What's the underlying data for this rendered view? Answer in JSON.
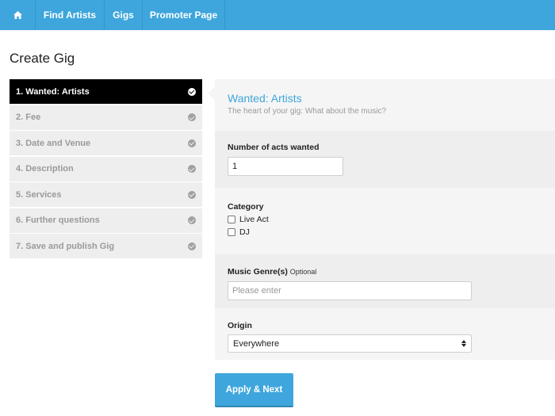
{
  "nav": {
    "home_icon": "home-icon",
    "items": [
      {
        "label": "Find Artists"
      },
      {
        "label": "Gigs"
      },
      {
        "label": "Promoter Page"
      }
    ]
  },
  "page": {
    "title": "Create Gig"
  },
  "steps": [
    {
      "label": "1. Wanted: Artists",
      "active": true,
      "icon": "check-circle-icon"
    },
    {
      "label": "2. Fee",
      "icon": "check-circle-icon"
    },
    {
      "label": "3. Date and Venue",
      "icon": "check-circle-icon"
    },
    {
      "label": "4. Description",
      "icon": "check-circle-icon"
    },
    {
      "label": "5. Services",
      "icon": "check-circle-icon"
    },
    {
      "label": "6. Further questions",
      "icon": "check-circle-icon"
    },
    {
      "label": "7. Save and publish Gig",
      "icon": "check-circle-icon"
    }
  ],
  "panel": {
    "title": "Wanted: Artists",
    "subtitle": "The heart of your gig: What about the music?"
  },
  "form": {
    "acts": {
      "label": "Number of acts wanted",
      "value": "1"
    },
    "category": {
      "label": "Category",
      "options": [
        {
          "label": "Live Act",
          "checked": false
        },
        {
          "label": "DJ",
          "checked": false
        }
      ]
    },
    "genre": {
      "label": "Music Genre(s)",
      "optional": "Optional",
      "placeholder": "Please enter",
      "value": ""
    },
    "origin": {
      "label": "Origin",
      "selected": "Everywhere"
    }
  },
  "actions": {
    "apply_label": "Apply & Next"
  },
  "colors": {
    "accent": "#3ea6dc",
    "active_step": "#000000"
  }
}
